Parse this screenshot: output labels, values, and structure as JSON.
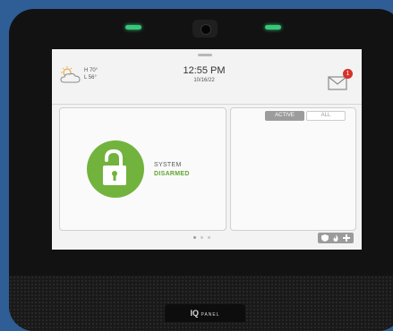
{
  "weather": {
    "high": "H 70°",
    "low": "L 56°",
    "icon": "partly-cloudy-icon"
  },
  "clock": {
    "time": "12:55 PM",
    "date": "10/16/22"
  },
  "messages": {
    "icon": "envelope-icon",
    "count": "1"
  },
  "system": {
    "line1": "SYSTEM",
    "line2": "DISARMED",
    "icon": "unlocked-padlock-icon"
  },
  "tabs": [
    {
      "label": "ACTIVE",
      "selected": true
    },
    {
      "label": "ALL",
      "selected": false
    }
  ],
  "pager": {
    "pages": 3,
    "current": 1
  },
  "quick_actions": [
    {
      "icon": "shield-icon"
    },
    {
      "icon": "fire-icon"
    },
    {
      "icon": "medical-cross-icon"
    }
  ],
  "device": {
    "brand": "IQ",
    "brand_sub": "PANEL"
  },
  "colors": {
    "accent_green": "#72b33e",
    "status_green": "#62a52f",
    "badge_red": "#d8312b",
    "led_green": "#38c77a"
  }
}
